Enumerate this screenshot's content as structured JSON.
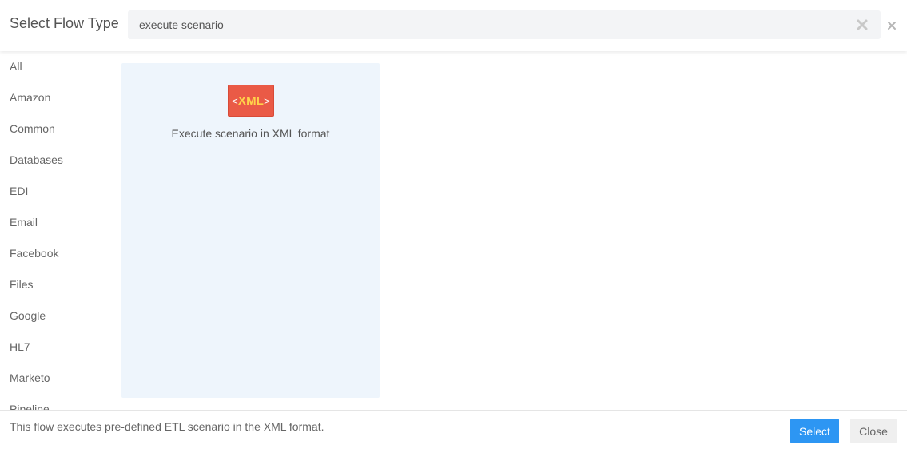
{
  "header": {
    "title": "Select Flow Type",
    "search": {
      "value": "execute scenario",
      "placeholder": ""
    }
  },
  "sidebar": {
    "items": [
      {
        "label": "All"
      },
      {
        "label": "Amazon"
      },
      {
        "label": "Common"
      },
      {
        "label": "Databases"
      },
      {
        "label": "EDI"
      },
      {
        "label": "Email"
      },
      {
        "label": "Facebook"
      },
      {
        "label": "Files"
      },
      {
        "label": "Google"
      },
      {
        "label": "HL7"
      },
      {
        "label": "Marketo"
      },
      {
        "label": "Pipeline"
      }
    ]
  },
  "results": {
    "cards": [
      {
        "label": "Execute scenario in XML format",
        "icon": {
          "name": "xml-icon",
          "open": "<",
          "text": "XML",
          "close": ">",
          "bg_color": "#ea5a46",
          "text_color": "#ffd34a"
        },
        "selected": true
      }
    ]
  },
  "footer": {
    "description": "This flow executes pre-defined ETL scenario in the XML format.",
    "select_label": "Select",
    "close_label": "Close"
  },
  "colors": {
    "accent": "#2d96f3",
    "card_selected_bg": "#eef5fc"
  }
}
